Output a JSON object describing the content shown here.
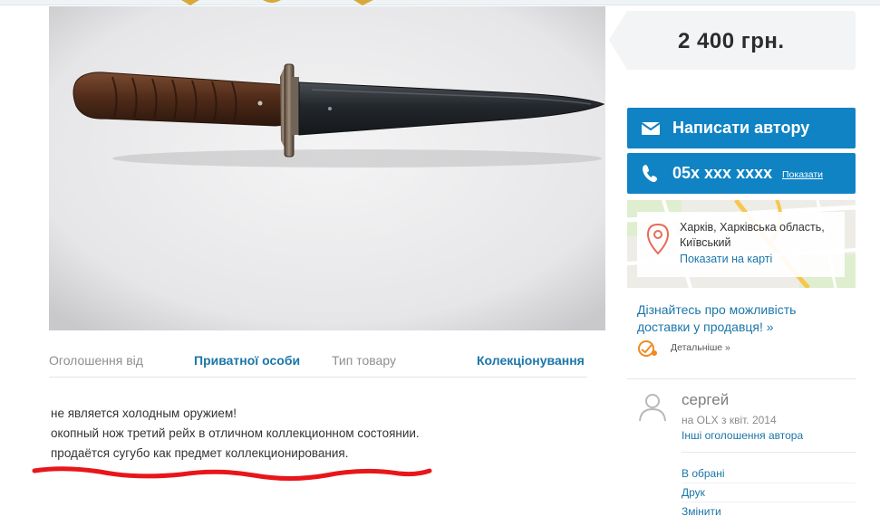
{
  "listing": {
    "price": "2 400 грн.",
    "details": [
      {
        "label": "Оголошення від",
        "value": "Приватної особи"
      },
      {
        "label": "Тип товару",
        "value": "Колекціонування"
      }
    ],
    "description": [
      "не является холодным оружием!",
      "окопный нож третий рейх в отличном коллекционном состоянии.",
      "продаётся сугубо как предмет коллекционирования."
    ]
  },
  "contact": {
    "write_label": "Написати автору",
    "phone": "05x xxx xxxx",
    "show_phone": "Показати"
  },
  "location": {
    "line1": "Харків, Харківська область,",
    "line2": "Київський",
    "map_link": "Показати на карті"
  },
  "delivery": {
    "line1": "Дізнайтесь про можливість",
    "line2": "доставки у продавця! »",
    "details_link": "Детальніше »"
  },
  "seller": {
    "name": "сергей",
    "since": "на OLX з квіт. 2014",
    "more_ads": "Інші оголошення автора"
  },
  "actions": [
    "В обрані",
    "Друк",
    "Змінити"
  ],
  "colors": {
    "accent": "#0f83c4",
    "link": "#1b76a8",
    "price_bg": "#f2f4f5",
    "annotation": "#e8161b"
  },
  "icons": [
    "envelope-icon",
    "phone-icon",
    "map-pin-icon",
    "delivery-truck-icon",
    "user-avatar-icon"
  ]
}
